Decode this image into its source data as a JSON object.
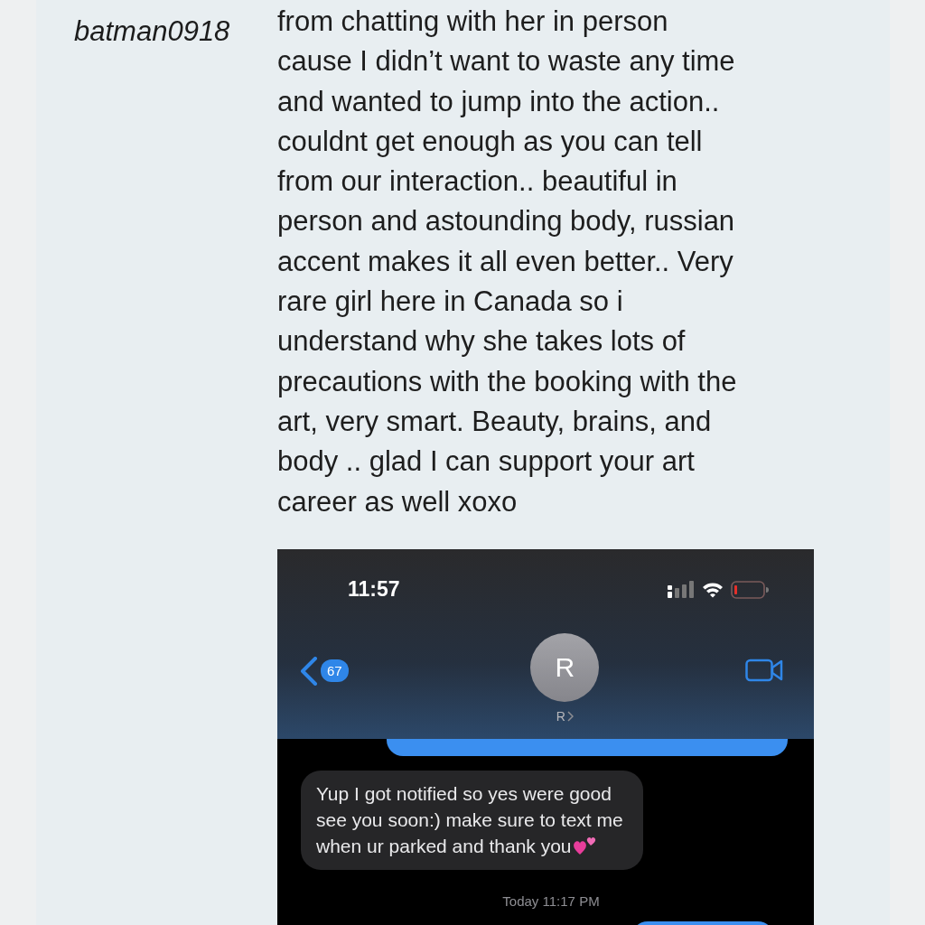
{
  "review": {
    "author": "batman0918",
    "text": "from chatting with her in person\ncause I didn’t want to waste any time\nand wanted to jump into the action..\ncouldnt get enough as you can tell\nfrom our interaction.. beautiful in\nperson and astounding body, russian\naccent makes it all even better.. Very\nrare girl here in Canada so i\nunderstand why she takes lots of\nprecautions with the booking with the\nart, very smart. Beauty, brains, and\nbody .. glad I can support your art\ncareer as well xoxo"
  },
  "phone_screenshot": {
    "status_bar": {
      "time": "11:57"
    },
    "header": {
      "back_count": "67",
      "avatar_initial": "R",
      "contact_name": "R"
    },
    "messages": [
      {
        "kind": "sent"
      },
      {
        "kind": "received",
        "text": "Yup I got notified so yes were good\nsee you soon:) make sure to text me\nwhen ur parked and thank you"
      },
      {
        "kind": "timestamp",
        "text": "Today 11:17 PM"
      },
      {
        "kind": "sent"
      }
    ]
  }
}
